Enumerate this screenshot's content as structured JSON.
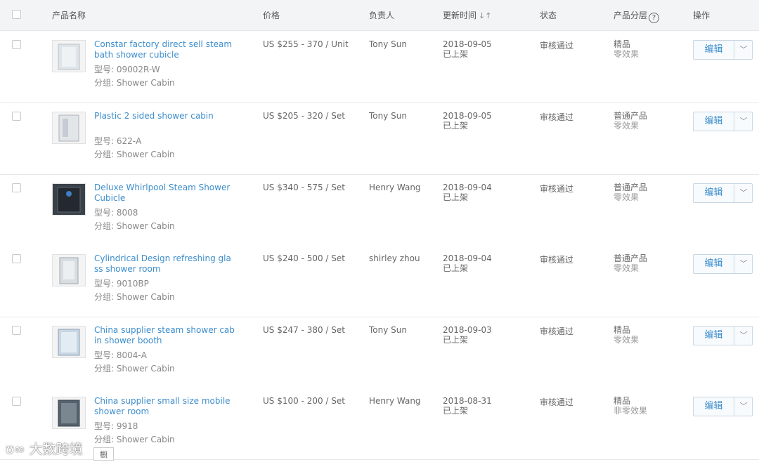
{
  "header": {
    "product_name": "产品名称",
    "price": "价格",
    "owner": "负责人",
    "updated": "更新时间",
    "status": "状态",
    "tier": "产品分层",
    "help": "?",
    "action": "操作"
  },
  "rows": [
    {
      "name": "Constar factory direct sell steam bath shower cubicle",
      "model": "型号: 09002R-W",
      "group": "分组: Shower Cabin",
      "price": "US $255 - 370 / Unit",
      "owner": "Tony Sun",
      "date": "2018-09-05",
      "shelf": "已上架",
      "status": "审核通过",
      "tier": "精品",
      "effect": "零效果",
      "edit": "编辑"
    },
    {
      "name": "Plastic 2 sided shower cabin",
      "model": "型号: 622-A",
      "group": "分组: Shower Cabin",
      "price": "US $205 - 320 / Set",
      "owner": "Tony Sun",
      "date": "2018-09-05",
      "shelf": "已上架",
      "status": "审核通过",
      "tier": "普通产品",
      "effect": "零效果",
      "edit": "编辑"
    },
    {
      "name": "Deluxe Whirlpool Steam Shower Cubicle",
      "model": "型号: 8008",
      "group": "分组: Shower Cabin",
      "price": "US $340 - 575 / Set",
      "owner": "Henry Wang",
      "date": "2018-09-04",
      "shelf": "已上架",
      "status": "审核通过",
      "tier": "普通产品",
      "effect": "零效果",
      "edit": "编辑"
    },
    {
      "name": "Cylindrical Design refreshing glass shower room",
      "model": "型号: 9010BP",
      "group": "分组: Shower Cabin",
      "price": "US $240 - 500 / Set",
      "owner": "shirley zhou",
      "date": "2018-09-04",
      "shelf": "已上架",
      "status": "审核通过",
      "tier": "普通产品",
      "effect": "零效果",
      "edit": "编辑"
    },
    {
      "name": "China supplier steam shower cabin shower booth",
      "model": "型号: 8004-A",
      "group": "分组: Shower Cabin",
      "price": "US $247 - 380 / Set",
      "owner": "Tony Sun",
      "date": "2018-09-03",
      "shelf": "已上架",
      "status": "审核通过",
      "tier": "精品",
      "effect": "零效果",
      "edit": "编辑"
    },
    {
      "name": "China supplier small size mobile shower room",
      "model": "型号: 9918",
      "group": "分组: Shower Cabin",
      "price": "US $100 - 200 / Set",
      "owner": "Henry Wang",
      "date": "2018-08-31",
      "shelf": "已上架",
      "status": "审核通过",
      "tier": "精品",
      "effect": "非零效果",
      "edit": "编辑"
    }
  ],
  "watermark": "大数跨境",
  "stub": "橱",
  "colors": {
    "link": "#3c8dcc",
    "header_bg": "#f3f4f6",
    "border": "#e8e8e8"
  }
}
